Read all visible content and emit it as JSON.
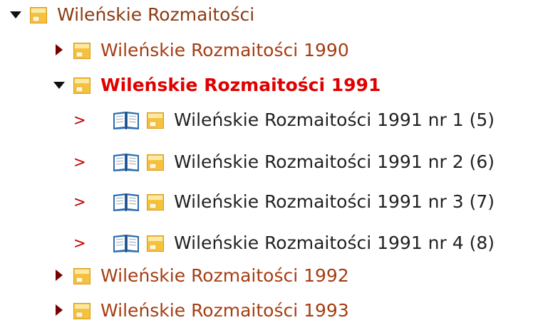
{
  "colors": {
    "root_label": "#8a3b12",
    "year_label": "#a63d12",
    "selected_label": "#e00000",
    "issue_label": "#222222",
    "chevron": "#c00000",
    "folder_fill": "#f7c744",
    "book_blue": "#2c6cb0"
  },
  "tree": {
    "root": {
      "label": "Wileńskie Rozmaitości",
      "expanded": true,
      "icon": "folder-icon"
    },
    "years": [
      {
        "label": "Wileńskie Rozmaitości 1990",
        "expanded": false,
        "icon": "folder-icon"
      },
      {
        "label": "Wileńskie Rozmaitości 1991",
        "expanded": true,
        "selected": true,
        "icon": "folder-icon"
      },
      {
        "label": "Wileńskie Rozmaitości 1992",
        "expanded": false,
        "icon": "folder-icon"
      },
      {
        "label": "Wileńskie Rozmaitości 1993",
        "expanded": false,
        "icon": "folder-icon"
      }
    ],
    "issues": [
      {
        "label": "Wileńskie Rozmaitości 1991 nr 1 (5)",
        "icon": "book-icon"
      },
      {
        "label": "Wileńskie Rozmaitości 1991 nr 2 (6)",
        "icon": "book-icon"
      },
      {
        "label": "Wileńskie Rozmaitości 1991 nr 3 (7)",
        "icon": "book-icon"
      },
      {
        "label": "Wileńskie Rozmaitości 1991 nr 4 (8)",
        "icon": "book-icon"
      }
    ]
  }
}
